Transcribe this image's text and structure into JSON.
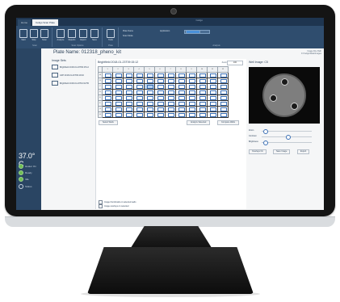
{
  "window": {
    "tabs": [
      "Home",
      "Celigo Scan Plate"
    ],
    "title": "Celigo"
  },
  "ribbon": {
    "buttons": [
      "Start",
      "Stop",
      "Scan",
      "Analyze",
      "Reports",
      "Export",
      "Save",
      "Tools"
    ],
    "groups": [
      "Scan",
      "Scan Options",
      "Plate",
      "Analysis"
    ],
    "fields": [
      "Plate Name",
      "Scan Mode",
      "Application"
    ]
  },
  "left_panel": {
    "temperature": "37.0° C",
    "items": [
      "Heater On",
      "Ready",
      "Idle",
      "Status"
    ]
  },
  "header": {
    "plate_title": "Plate Name:  012318_pheno_kit",
    "right_lines": [
      "Image File Path",
      "C:\\Celigo\\Data\\Images"
    ]
  },
  "image_sets": {
    "heading": "Image Sets",
    "items": [
      "Brightfield 2018-01-23T09:15:12",
      "GFP 2018-01-23T09:19:40",
      "Brightfield 2018-01-23T10:02:55"
    ]
  },
  "plate": {
    "title": "Brightfield 2018-01-23T09:15:12",
    "zoom_label": "Zoom",
    "zoom_value": "100",
    "columns": [
      "1",
      "2",
      "3",
      "4",
      "5",
      "6",
      "7",
      "8",
      "9",
      "10",
      "11",
      "12"
    ],
    "rows": [
      "A",
      "B",
      "C",
      "D",
      "E",
      "F",
      "G",
      "H"
    ],
    "selected_well": "C5",
    "buttons": [
      "Select Wells",
      "Analyze Selected",
      "Compare Wells"
    ],
    "checkboxes": [
      "Image thumbnails on selected wells",
      "Image overlays on selected"
    ]
  },
  "well_image": {
    "title": "Well Image: C5",
    "controls": [
      "Zoom",
      "Contrast",
      "Brightness"
    ],
    "buttons": [
      "Overlays On",
      "Save Image",
      "Export"
    ]
  }
}
